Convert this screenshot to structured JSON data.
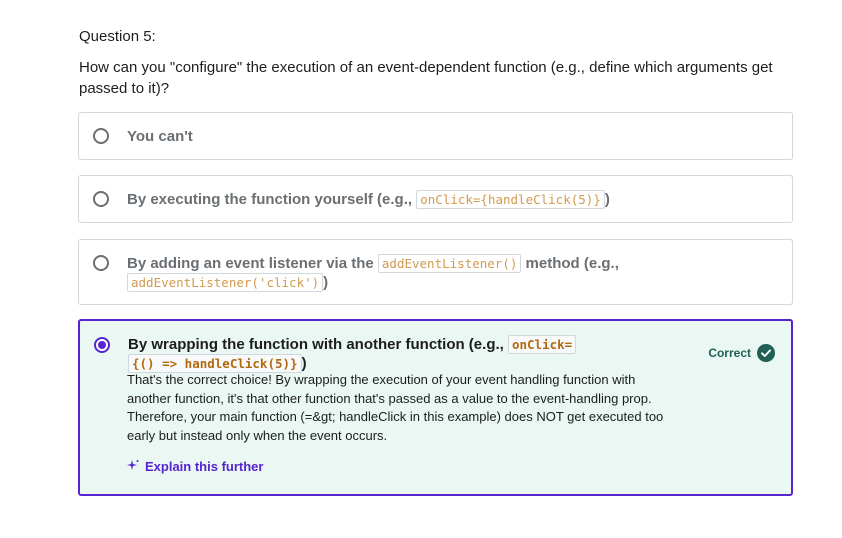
{
  "question": {
    "number": "Question 5:",
    "text": "How can you \"configure\" the execution of an event-dependent function (e.g., define which arguments get passed to it)?"
  },
  "options": [
    {
      "text_before": "You can't"
    },
    {
      "text_before": "By executing the function yourself (e.g., ",
      "code": "onClick={handleClick(5)}",
      "text_after": ")"
    },
    {
      "text_before": "By adding an event listener via the ",
      "code": "addEventListener()",
      "text_middle": " method (e.g., ",
      "code2": "addEventListener('click')",
      "text_after": ")"
    },
    {
      "text_before": "By wrapping the function with another function (e.g., ",
      "code": "onClick=",
      "code2": "{() => handleClick(5)}",
      "text_after": ")",
      "selected": true
    }
  ],
  "feedback": {
    "status": "Correct",
    "message": "That's the correct choice! By wrapping the execution of your event handling function with another function, it's that other function that's passed as a value to the event-handling prop. Therefore, your main function (=&gt; handleClick in this example) does NOT get executed too early but instead only when the event occurs.",
    "explain_label": "Explain this further"
  },
  "colors": {
    "accent": "#5624d0",
    "success": "#1e6055",
    "selected_bg": "#eaf7f3"
  }
}
